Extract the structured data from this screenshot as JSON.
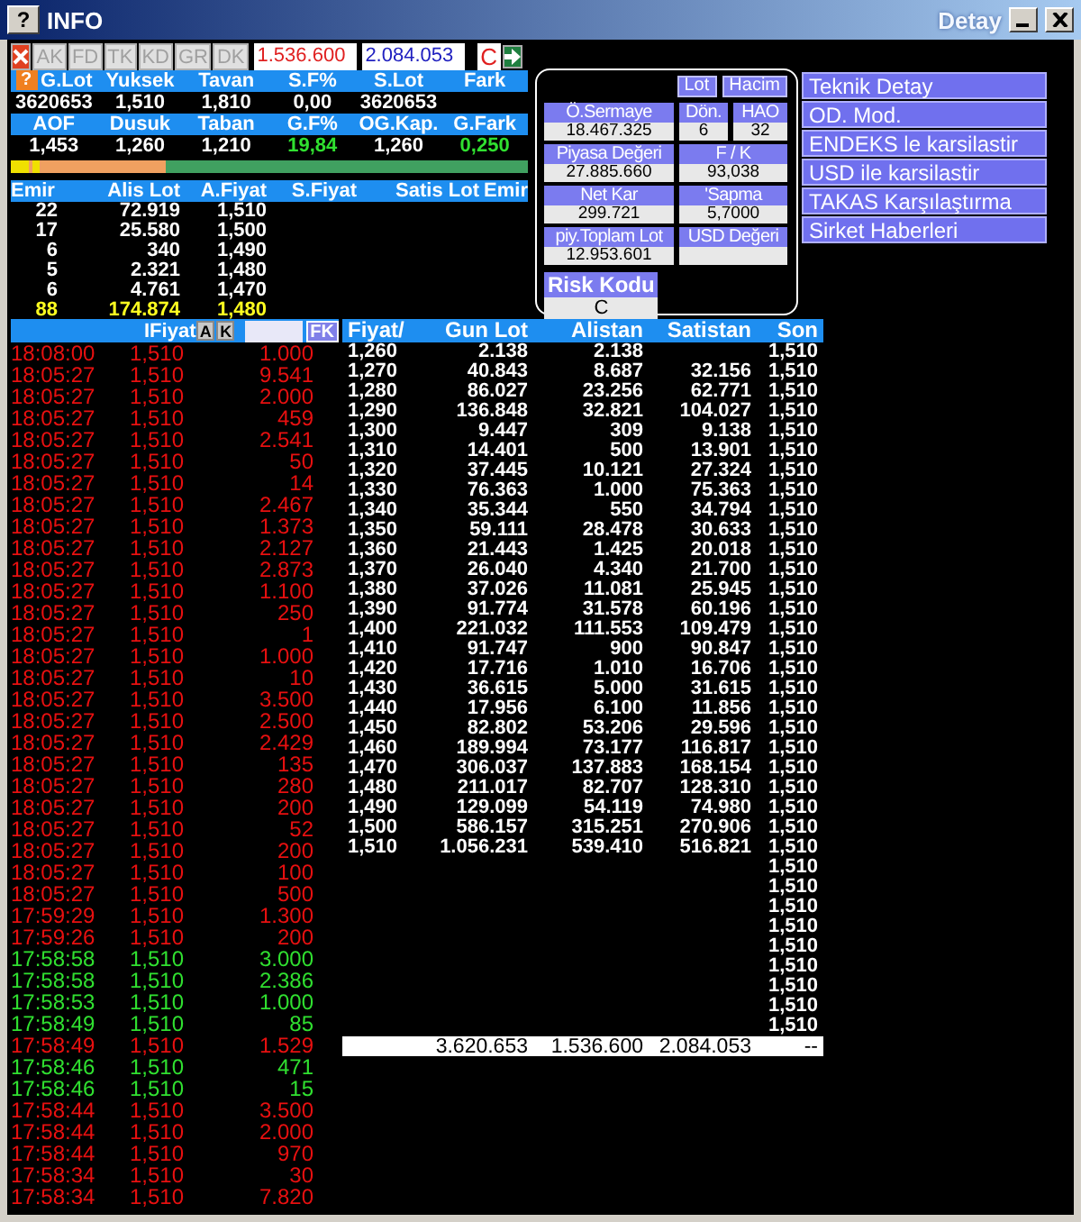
{
  "window": {
    "help_button": "?",
    "title": "INFO",
    "detail_title": "Detay"
  },
  "summary_help": "?",
  "toolbar": {
    "tabs": [
      "AK",
      "FD",
      "TK",
      "KD",
      "GR",
      "DK"
    ],
    "buy_total": "1.536.600",
    "sell_total": "2.084.053",
    "mode": "C"
  },
  "summary": [
    {
      "label": "G.Lot",
      "value": "3620653",
      "positive": false
    },
    {
      "label": "Yuksek",
      "value": "1,510",
      "positive": false
    },
    {
      "label": "Tavan",
      "value": "1,810",
      "positive": false
    },
    {
      "label": "S.F%",
      "value": "0,00",
      "positive": false
    },
    {
      "label": "S.Lot",
      "value": "3620653",
      "positive": false
    },
    {
      "label": "Fark"
    },
    {
      "label": "AOF",
      "value": "1,453",
      "positive": false
    },
    {
      "label": "Dusuk",
      "value": "1,260",
      "positive": false
    },
    {
      "label": "Taban",
      "value": "1,210",
      "positive": false
    },
    {
      "label": "G.F%",
      "value": "19,84",
      "positive": true
    },
    {
      "label": "OG.Kap.",
      "value": "1,260",
      "positive": false
    },
    {
      "label": "G.Fark",
      "value": "0,250",
      "positive": true
    }
  ],
  "range_bar": {
    "level": 0.3
  },
  "depth": {
    "columns": [
      "Emir",
      "Alis Lot",
      "A.Fiyat",
      "S.Fiyat",
      "Satis Lot",
      "Emir"
    ],
    "rows": [
      {
        "orders": "22",
        "lot": "72.919",
        "price": "1,510",
        "total": false
      },
      {
        "orders": "17",
        "lot": "25.580",
        "price": "1,500",
        "total": false
      },
      {
        "orders": "6",
        "lot": "340",
        "price": "1,490",
        "total": false
      },
      {
        "orders": "5",
        "lot": "2.321",
        "price": "1,480",
        "total": false
      },
      {
        "orders": "6",
        "lot": "4.761",
        "price": "1,470",
        "total": false
      },
      {
        "orders": "88",
        "lot": "174.874",
        "price": "1,480",
        "total": true
      }
    ]
  },
  "trades": {
    "header": "IFiyat",
    "buttons": [
      "A",
      "K"
    ],
    "filter_button": "FK",
    "rows": [
      {
        "time": "18:08:00",
        "price": "1,510",
        "lot": "1.000",
        "kind": "sell"
      },
      {
        "time": "18:05:27",
        "price": "1,510",
        "lot": "9.541",
        "kind": "sell"
      },
      {
        "time": "18:05:27",
        "price": "1,510",
        "lot": "2.000",
        "kind": "sell"
      },
      {
        "time": "18:05:27",
        "price": "1,510",
        "lot": "459",
        "kind": "sell"
      },
      {
        "time": "18:05:27",
        "price": "1,510",
        "lot": "2.541",
        "kind": "sell"
      },
      {
        "time": "18:05:27",
        "price": "1,510",
        "lot": "50",
        "kind": "sell"
      },
      {
        "time": "18:05:27",
        "price": "1,510",
        "lot": "14",
        "kind": "sell"
      },
      {
        "time": "18:05:27",
        "price": "1,510",
        "lot": "2.467",
        "kind": "sell"
      },
      {
        "time": "18:05:27",
        "price": "1,510",
        "lot": "1.373",
        "kind": "sell"
      },
      {
        "time": "18:05:27",
        "price": "1,510",
        "lot": "2.127",
        "kind": "sell"
      },
      {
        "time": "18:05:27",
        "price": "1,510",
        "lot": "2.873",
        "kind": "sell"
      },
      {
        "time": "18:05:27",
        "price": "1,510",
        "lot": "1.100",
        "kind": "sell"
      },
      {
        "time": "18:05:27",
        "price": "1,510",
        "lot": "250",
        "kind": "sell"
      },
      {
        "time": "18:05:27",
        "price": "1,510",
        "lot": "1",
        "kind": "sell"
      },
      {
        "time": "18:05:27",
        "price": "1,510",
        "lot": "1.000",
        "kind": "sell"
      },
      {
        "time": "18:05:27",
        "price": "1,510",
        "lot": "10",
        "kind": "sell"
      },
      {
        "time": "18:05:27",
        "price": "1,510",
        "lot": "3.500",
        "kind": "sell"
      },
      {
        "time": "18:05:27",
        "price": "1,510",
        "lot": "2.500",
        "kind": "sell"
      },
      {
        "time": "18:05:27",
        "price": "1,510",
        "lot": "2.429",
        "kind": "sell"
      },
      {
        "time": "18:05:27",
        "price": "1,510",
        "lot": "135",
        "kind": "sell"
      },
      {
        "time": "18:05:27",
        "price": "1,510",
        "lot": "280",
        "kind": "sell"
      },
      {
        "time": "18:05:27",
        "price": "1,510",
        "lot": "200",
        "kind": "sell"
      },
      {
        "time": "18:05:27",
        "price": "1,510",
        "lot": "52",
        "kind": "sell"
      },
      {
        "time": "18:05:27",
        "price": "1,510",
        "lot": "200",
        "kind": "sell"
      },
      {
        "time": "18:05:27",
        "price": "1,510",
        "lot": "100",
        "kind": "sell"
      },
      {
        "time": "18:05:27",
        "price": "1,510",
        "lot": "500",
        "kind": "sell"
      },
      {
        "time": "17:59:29",
        "price": "1,510",
        "lot": "1.300",
        "kind": "sell"
      },
      {
        "time": "17:59:26",
        "price": "1,510",
        "lot": "200",
        "kind": "sell"
      },
      {
        "time": "17:58:58",
        "price": "1,510",
        "lot": "3.000",
        "kind": "buy"
      },
      {
        "time": "17:58:58",
        "price": "1,510",
        "lot": "2.386",
        "kind": "buy"
      },
      {
        "time": "17:58:53",
        "price": "1,510",
        "lot": "1.000",
        "kind": "buy"
      },
      {
        "time": "17:58:49",
        "price": "1,510",
        "lot": "85",
        "kind": "buy"
      },
      {
        "time": "17:58:49",
        "price": "1,510",
        "lot": "1.529",
        "kind": "sell"
      },
      {
        "time": "17:58:46",
        "price": "1,510",
        "lot": "471",
        "kind": "buy"
      },
      {
        "time": "17:58:46",
        "price": "1,510",
        "lot": "15",
        "kind": "buy"
      },
      {
        "time": "17:58:44",
        "price": "1,510",
        "lot": "3.500",
        "kind": "sell"
      },
      {
        "time": "17:58:44",
        "price": "1,510",
        "lot": "2.000",
        "kind": "sell"
      },
      {
        "time": "17:58:44",
        "price": "1,510",
        "lot": "970",
        "kind": "sell"
      },
      {
        "time": "17:58:34",
        "price": "1,510",
        "lot": "30",
        "kind": "sell"
      },
      {
        "time": "17:58:34",
        "price": "1,510",
        "lot": "7.820",
        "kind": "sell"
      }
    ]
  },
  "price_table": {
    "columns": [
      "Fiyat/",
      "Gun Lot",
      "Alistan",
      "Satistan",
      "Son"
    ],
    "rows": [
      {
        "price": "1,260",
        "day_lot": "2.138",
        "bought": "2.138",
        "last": "1,510"
      },
      {
        "price": "1,270",
        "day_lot": "40.843",
        "bought": "8.687",
        "sold": "32.156",
        "last": "1,510"
      },
      {
        "price": "1,280",
        "day_lot": "86.027",
        "bought": "23.256",
        "sold": "62.771",
        "last": "1,510"
      },
      {
        "price": "1,290",
        "day_lot": "136.848",
        "bought": "32.821",
        "sold": "104.027",
        "last": "1,510"
      },
      {
        "price": "1,300",
        "day_lot": "9.447",
        "bought": "309",
        "sold": "9.138",
        "last": "1,510"
      },
      {
        "price": "1,310",
        "day_lot": "14.401",
        "bought": "500",
        "sold": "13.901",
        "last": "1,510"
      },
      {
        "price": "1,320",
        "day_lot": "37.445",
        "bought": "10.121",
        "sold": "27.324",
        "last": "1,510"
      },
      {
        "price": "1,330",
        "day_lot": "76.363",
        "bought": "1.000",
        "sold": "75.363",
        "last": "1,510"
      },
      {
        "price": "1,340",
        "day_lot": "35.344",
        "bought": "550",
        "sold": "34.794",
        "last": "1,510"
      },
      {
        "price": "1,350",
        "day_lot": "59.111",
        "bought": "28.478",
        "sold": "30.633",
        "last": "1,510"
      },
      {
        "price": "1,360",
        "day_lot": "21.443",
        "bought": "1.425",
        "sold": "20.018",
        "last": "1,510"
      },
      {
        "price": "1,370",
        "day_lot": "26.040",
        "bought": "4.340",
        "sold": "21.700",
        "last": "1,510"
      },
      {
        "price": "1,380",
        "day_lot": "37.026",
        "bought": "11.081",
        "sold": "25.945",
        "last": "1,510"
      },
      {
        "price": "1,390",
        "day_lot": "91.774",
        "bought": "31.578",
        "sold": "60.196",
        "last": "1,510"
      },
      {
        "price": "1,400",
        "day_lot": "221.032",
        "bought": "111.553",
        "sold": "109.479",
        "last": "1,510"
      },
      {
        "price": "1,410",
        "day_lot": "91.747",
        "bought": "900",
        "sold": "90.847",
        "last": "1,510"
      },
      {
        "price": "1,420",
        "day_lot": "17.716",
        "bought": "1.010",
        "sold": "16.706",
        "last": "1,510"
      },
      {
        "price": "1,430",
        "day_lot": "36.615",
        "bought": "5.000",
        "sold": "31.615",
        "last": "1,510"
      },
      {
        "price": "1,440",
        "day_lot": "17.956",
        "bought": "6.100",
        "sold": "11.856",
        "last": "1,510"
      },
      {
        "price": "1,450",
        "day_lot": "82.802",
        "bought": "53.206",
        "sold": "29.596",
        "last": "1,510"
      },
      {
        "price": "1,460",
        "day_lot": "189.994",
        "bought": "73.177",
        "sold": "116.817",
        "last": "1,510"
      },
      {
        "price": "1,470",
        "day_lot": "306.037",
        "bought": "137.883",
        "sold": "168.154",
        "last": "1,510"
      },
      {
        "price": "1,480",
        "day_lot": "211.017",
        "bought": "82.707",
        "sold": "128.310",
        "last": "1,510"
      },
      {
        "price": "1,490",
        "day_lot": "129.099",
        "bought": "54.119",
        "sold": "74.980",
        "last": "1,510"
      },
      {
        "price": "1,500",
        "day_lot": "586.157",
        "bought": "315.251",
        "sold": "270.906",
        "last": "1,510"
      },
      {
        "price": "1,510",
        "day_lot": "1.056.231",
        "bought": "539.410",
        "sold": "516.821",
        "last": "1,510"
      },
      {
        "last": "1,510"
      },
      {
        "last": "1,510"
      },
      {
        "last": "1,510"
      },
      {
        "last": "1,510"
      },
      {
        "last": "1,510"
      },
      {
        "last": "1,510"
      },
      {
        "last": "1,510"
      },
      {
        "last": "1,510"
      },
      {
        "last": "1,510"
      }
    ],
    "totals": {
      "day_lot": "3.620.653",
      "bought": "1.536.600",
      "sold": "2.084.053",
      "last": "--"
    }
  },
  "detail": {
    "buttons": [
      "Lot",
      "Hacim"
    ],
    "fields": [
      {
        "label": "Ö.Sermaye",
        "value": "18.467.325"
      },
      {
        "label": "Dön.",
        "value": "6"
      },
      {
        "label": "HAO",
        "value": "32"
      },
      {
        "label": "Piyasa Değeri",
        "value": "27.885.660"
      },
      {
        "label": "F / K",
        "value": "93,038"
      },
      {
        "label": "Net Kar",
        "value": "299.721"
      },
      {
        "label": "'Sapma",
        "value": "5,7000"
      },
      {
        "label": "piy.Toplam Lot",
        "value": "12.953.601"
      },
      {
        "label": "USD Değeri"
      }
    ],
    "risk": {
      "label": "Risk Kodu",
      "value": "C"
    }
  },
  "links": [
    "Teknik Detay",
    "OD. Mod.",
    "ENDEKS le karsilastir",
    "USD ile karsilastir",
    "TAKAS Karşılaştırma",
    "Sirket Haberleri"
  ]
}
